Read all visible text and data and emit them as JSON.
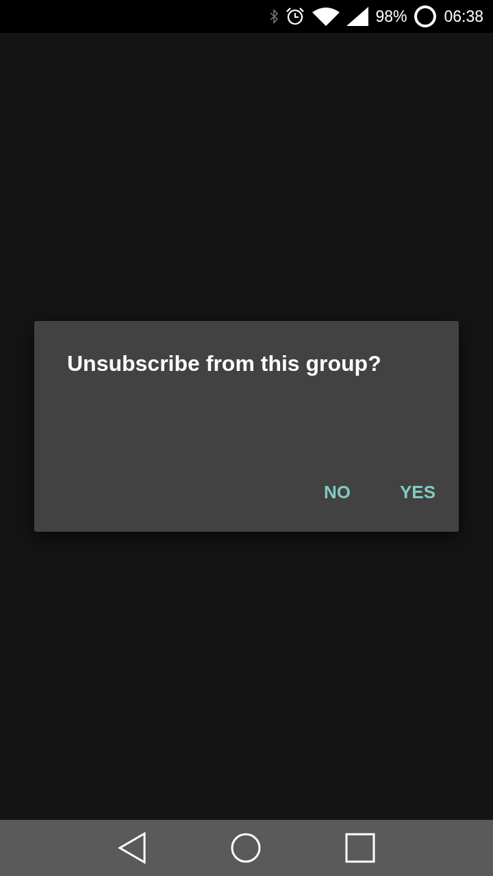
{
  "status_bar": {
    "battery": "98%",
    "time": "06:38"
  },
  "dialog": {
    "title": "Unsubscribe from this group?",
    "buttons": [
      "NO",
      "YES"
    ]
  }
}
